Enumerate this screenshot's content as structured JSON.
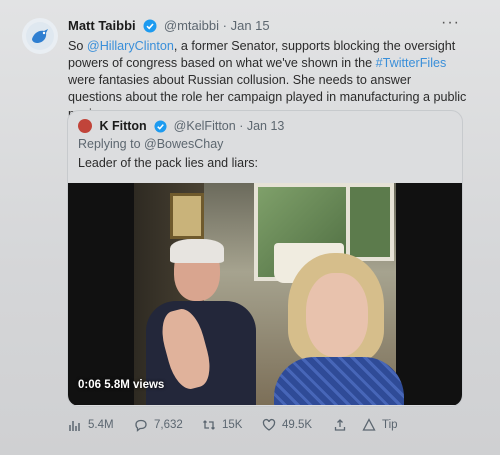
{
  "tweet": {
    "author_name": "Matt Taibbi",
    "handle": "@mtaibbi",
    "separator": "·",
    "date": "Jan 15",
    "more": "···",
    "text_parts": {
      "p1": "So ",
      "mention": "@HillaryClinton",
      "p2": ", a former Senator, supports blocking the oversight powers of congress based on what we've shown in the ",
      "hashtag": "#TwitterFiles",
      "p3": " were fantasies about Russian collusion. She needs to answer questions about the role her campaign played in manufacturing a public panic."
    }
  },
  "quote": {
    "author_name": "K Fitton",
    "handle": "@KelFitton",
    "separator": "·",
    "date": "Jan 13",
    "reply_prefix": "Replying to ",
    "reply_handle": "@BowesChay",
    "text": "Leader of the pack lies and liars:",
    "video": {
      "duration": "0:06",
      "views": "5.8M views"
    }
  },
  "actions": {
    "views": "5.4M",
    "replies": "7,632",
    "retweets": "15K",
    "likes": "49.5K",
    "tip": "Tip"
  },
  "colors": {
    "link": "#3a8fd9",
    "verified": "#1d9bf0"
  }
}
